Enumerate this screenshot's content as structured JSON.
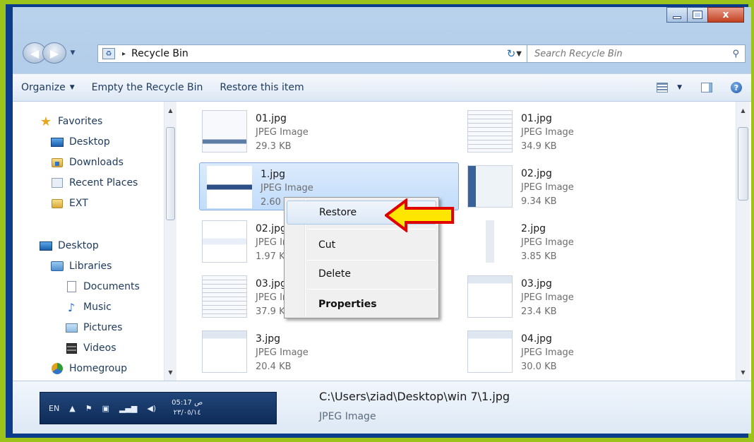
{
  "window": {
    "caption": {
      "minimize": "–",
      "maximize": "□",
      "close": "x"
    }
  },
  "address": {
    "separator": "▸",
    "location": "Recycle Bin",
    "dropdown": "▼",
    "refresh": "↻"
  },
  "search": {
    "placeholder": "Search Recycle Bin",
    "icon": "search-icon"
  },
  "toolbar": {
    "organize_label": "Organize",
    "empty_label": "Empty the Recycle Bin",
    "restore_label": "Restore this item",
    "dropdown_glyph": "▼"
  },
  "sidebar": {
    "items": [
      {
        "label": "Favorites",
        "icon": "star-icon"
      },
      {
        "label": "Desktop",
        "icon": "desktop-icon"
      },
      {
        "label": "Downloads",
        "icon": "downloads-folder-icon"
      },
      {
        "label": "Recent Places",
        "icon": "recent-places-icon"
      },
      {
        "label": "EXT",
        "icon": "folder-icon"
      },
      {
        "label": "Desktop",
        "icon": "desktop-icon"
      },
      {
        "label": "Libraries",
        "icon": "libraries-icon"
      },
      {
        "label": "Documents",
        "icon": "document-icon"
      },
      {
        "label": "Music",
        "icon": "music-icon"
      },
      {
        "label": "Pictures",
        "icon": "pictures-icon"
      },
      {
        "label": "Videos",
        "icon": "videos-icon"
      },
      {
        "label": "Homegroup",
        "icon": "homegroup-icon"
      }
    ]
  },
  "files": [
    {
      "name": "01.jpg",
      "type": "JPEG Image",
      "size": "29.3 KB"
    },
    {
      "name": "01.jpg",
      "type": "JPEG Image",
      "size": "34.9 KB"
    },
    {
      "name": "1.jpg",
      "type": "JPEG Image",
      "size": "2.60 KB",
      "selected": true
    },
    {
      "name": "02.jpg",
      "type": "JPEG Image",
      "size": "9.34 KB"
    },
    {
      "name": "02.jpg",
      "type": "JPEG Image",
      "size": "1.97 KB"
    },
    {
      "name": "2.jpg",
      "type": "JPEG Image",
      "size": "3.85 KB"
    },
    {
      "name": "03.jpg",
      "type": "JPEG Image",
      "size": "37.9 KB"
    },
    {
      "name": "03.jpg",
      "type": "JPEG Image",
      "size": "23.4 KB"
    },
    {
      "name": "3.jpg",
      "type": "JPEG Image",
      "size": "20.4 KB"
    },
    {
      "name": "04.jpg",
      "type": "JPEG Image",
      "size": "30.0 KB"
    }
  ],
  "context_menu": {
    "items": [
      {
        "label": "Restore",
        "highlighted": true
      },
      {
        "label": "Cut"
      },
      {
        "label": "Delete"
      },
      {
        "label": "Properties",
        "bold": true
      }
    ]
  },
  "details": {
    "path": "C:\\Users\\ziad\\Desktop\\win 7\\1.jpg",
    "type": "JPEG Image",
    "taskbar": {
      "language": "EN",
      "time": "05:17 ص",
      "date": "٢٣/٠٥/١٤"
    }
  },
  "colors": {
    "frame": "#9bc31c",
    "arrow_fill": "#ffe600",
    "arrow_stroke": "#e00000",
    "selection": "#c1dcfb"
  }
}
